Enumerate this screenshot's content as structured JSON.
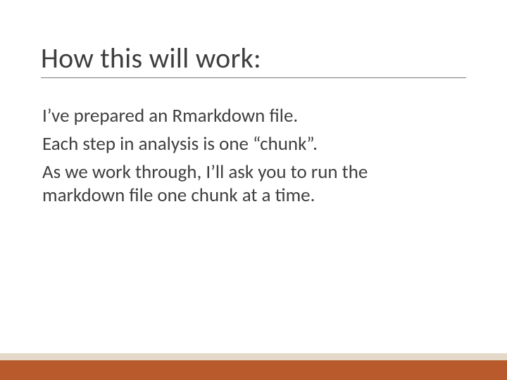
{
  "slide": {
    "title": "How this will work:",
    "paragraphs": [
      "I’ve prepared an Rmarkdown file.",
      "Each step in analysis is one “chunk”.",
      "As we work through, I’ll ask you to run the markdown file one chunk at a time."
    ]
  },
  "colors": {
    "accent_bar": "#b85a2b",
    "accent_strip": "#e4d8c8",
    "text": "#3f3f3f",
    "rule": "#7a7a7a"
  }
}
